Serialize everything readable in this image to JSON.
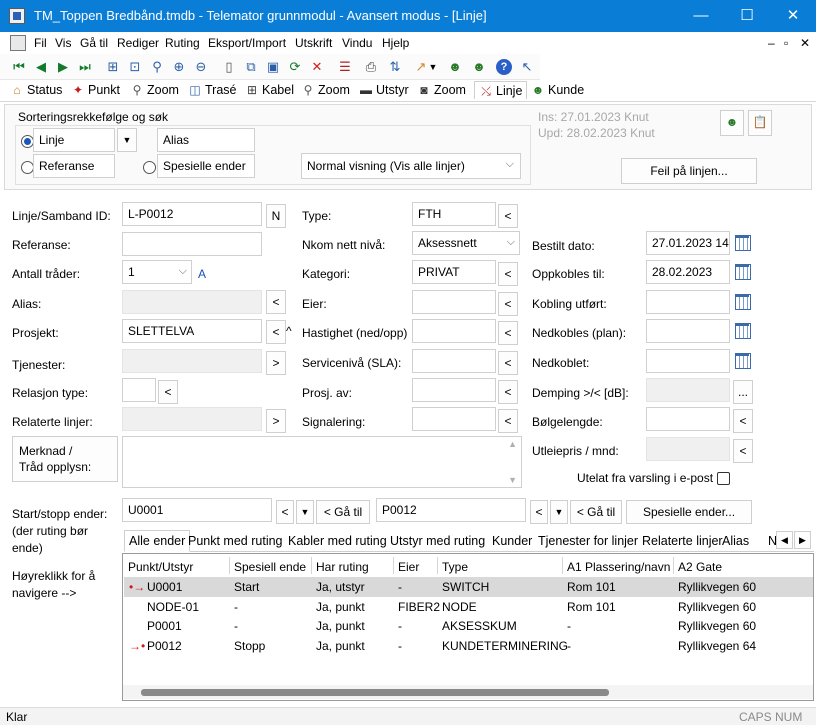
{
  "window": {
    "title": "TM_Toppen Bredbånd.tmdb - Telemator grunnmodul - Avansert modus - [Linje]",
    "minimize": "—",
    "maximize": "☐",
    "close": "✕"
  },
  "menu": [
    "Fil",
    "Vis",
    "Gå til",
    "Rediger",
    "Ruting",
    "Eksport/Import",
    "Utskrift",
    "Vindu",
    "Hjelp"
  ],
  "mdi_controls": [
    "–",
    "▫",
    "✕"
  ],
  "toolbar_icons": [
    "first-icon",
    "prev-icon",
    "next-icon",
    "last-icon",
    "tree-icon",
    "zoom-doc-icon",
    "search-icon",
    "search-plus-icon",
    "search-minus-icon",
    "new-doc-icon",
    "copy-icon",
    "save-icon",
    "refresh-icon",
    "delete-icon",
    "list-icon",
    "print-icon",
    "sort-icon",
    "chart-icon",
    "dropdown-arrow-icon",
    "user-icon",
    "user2-icon",
    "help-icon",
    "context-help-icon"
  ],
  "tabs": [
    {
      "label": "Status",
      "icon": "house-icon"
    },
    {
      "label": "Punkt",
      "icon": "point-icon"
    },
    {
      "label": "Zoom",
      "icon": "zoom-icon"
    },
    {
      "label": "Trasé",
      "icon": "route-icon"
    },
    {
      "label": "Kabel",
      "icon": "cable-icon"
    },
    {
      "label": "Zoom",
      "icon": "zoom-icon"
    },
    {
      "label": "Utstyr",
      "icon": "equipment-icon"
    },
    {
      "label": "Zoom",
      "icon": "zoom-icon"
    },
    {
      "label": "Linje",
      "icon": "line-icon"
    },
    {
      "label": "Kunde",
      "icon": "customer-icon"
    }
  ],
  "sort": {
    "group_label": "Sorteringsrekkefølge og søk",
    "radio_linje": "Linje",
    "radio_referanse": "Referanse",
    "radio_spesielle": "Spesielle ender",
    "alias_field": "Alias",
    "view_select": "Normal visning (Vis alle linjer)",
    "ins": "Ins: 27.01.2023 Knut",
    "upd": "Upd: 28.02.2023 Knut",
    "feil_button": "Feil på linjen..."
  },
  "form": {
    "linje_id_label": "Linje/Samband ID:",
    "linje_id_value": "L-P0012",
    "n_button": "N",
    "referanse_label": "Referanse:",
    "antall_label": "Antall tråder:",
    "antall_value": "1",
    "antall_a": "A",
    "alias_label": "Alias:",
    "prosjekt_label": "Prosjekt:",
    "prosjekt_value": "SLETTELVA",
    "tjenester_label": "Tjenester:",
    "relasjon_label": "Relasjon type:",
    "relaterte_label": "Relaterte linjer:",
    "merknad_label": "Merknad /\nTråd opplysn:",
    "type_label": "Type:",
    "type_value": "FTH",
    "nkom_label": "Nkom nett nivå:",
    "nkom_value": "Aksessnett",
    "kategori_label": "Kategori:",
    "kategori_value": "PRIVAT",
    "eier_label": "Eier:",
    "hastighet_label": "Hastighet (ned/opp)",
    "servicenivaa_label": "Servicenivå (SLA):",
    "prosj_av_label": "Prosj. av:",
    "signalering_label": "Signalering:",
    "bestilt_label": "Bestilt dato:",
    "bestilt_value": "27.01.2023 14",
    "oppkobles_label": "Oppkobles til:",
    "oppkobles_value": "28.02.2023",
    "kobling_label": "Kobling utført:",
    "nedkobles_label": "Nedkobles (plan):",
    "nedkoblet_label": "Nedkoblet:",
    "demping_label": "Demping >/< [dB]:",
    "bolge_label": "Bølgelengde:",
    "utleie_label": "Utleiepris / mnd:",
    "utelat_label": "Utelat fra varsling i e-post",
    "less": "<",
    "more": ">",
    "caret": "^",
    "ellipsis": "...",
    "dropdown": "▼"
  },
  "startstopp": {
    "label": "Start/stopp ender:\n(der ruting bør\nende)",
    "start_value": "U0001",
    "stop_value": "P0012",
    "goto": "< Gå til",
    "spesielle_button": "Spesielle ender...",
    "hint": "Høyreklikk for å\nnavigere -->"
  },
  "grid_tabs": [
    "Alle ender",
    "Punkt med ruting",
    "Kabler med ruting",
    "Utstyr med ruting",
    "Kunder",
    "Tjenester for linjer",
    "Relaterte linjer",
    "Alias",
    "N"
  ],
  "grid": {
    "headers": [
      "Punkt/Utstyr",
      "Spesiell ende",
      "Har ruting",
      "Eier",
      "Type",
      "A1 Plassering/navn",
      "A2 Gate"
    ],
    "rows": [
      {
        "marker": "•→",
        "cells": [
          "U0001",
          "Start",
          "Ja, utstyr",
          "-",
          "SWITCH",
          "Rom 101",
          "Ryllikvegen 60"
        ]
      },
      {
        "marker": "",
        "cells": [
          "NODE-01",
          "-",
          "Ja, punkt",
          "FIBER2",
          "NODE",
          "Rom 101",
          "Ryllikvegen 60"
        ]
      },
      {
        "marker": "",
        "cells": [
          "P0001",
          "-",
          "Ja, punkt",
          "-",
          "AKSESSKUM",
          "-",
          "Ryllikvegen 60"
        ]
      },
      {
        "marker": "→•",
        "cells": [
          "P0012",
          "Stopp",
          "Ja, punkt",
          "-",
          "KUNDETERMINERING",
          "-",
          "Ryllikvegen 64"
        ]
      }
    ]
  },
  "status": {
    "left": "Klar",
    "right": "CAPS NUM"
  }
}
